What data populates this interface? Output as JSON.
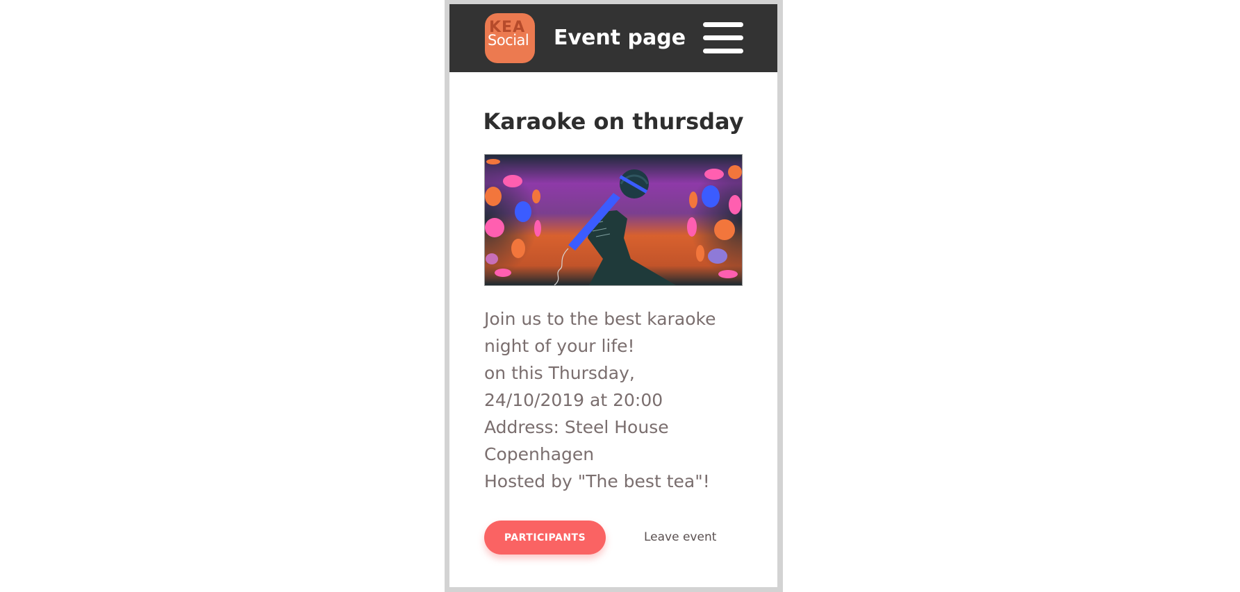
{
  "header": {
    "logo": {
      "line1": "KEA",
      "line2": "Social"
    },
    "title": "Event page",
    "menu_icon": "hamburger-menu-icon"
  },
  "event": {
    "title": "Karaoke on thursday",
    "image_icon": "karaoke-microphone-illustration",
    "description_lines": [
      "Join us to the best karaoke",
      "night of your life!",
      "on this Thursday,",
      "24/10/2019 at 20:00",
      "Address:  Steel House",
      "Copenhagen",
      "Hosted by \"The best tea\"!"
    ]
  },
  "actions": {
    "participants_label": "PARTICIPANTS",
    "leave_label": "Leave event"
  },
  "colors": {
    "header_bg": "#333333",
    "logo_bg": "#ec7a50",
    "button_bg": "#fa6363",
    "body_text": "#7a6e6e",
    "title_text": "#2e2e2e"
  }
}
